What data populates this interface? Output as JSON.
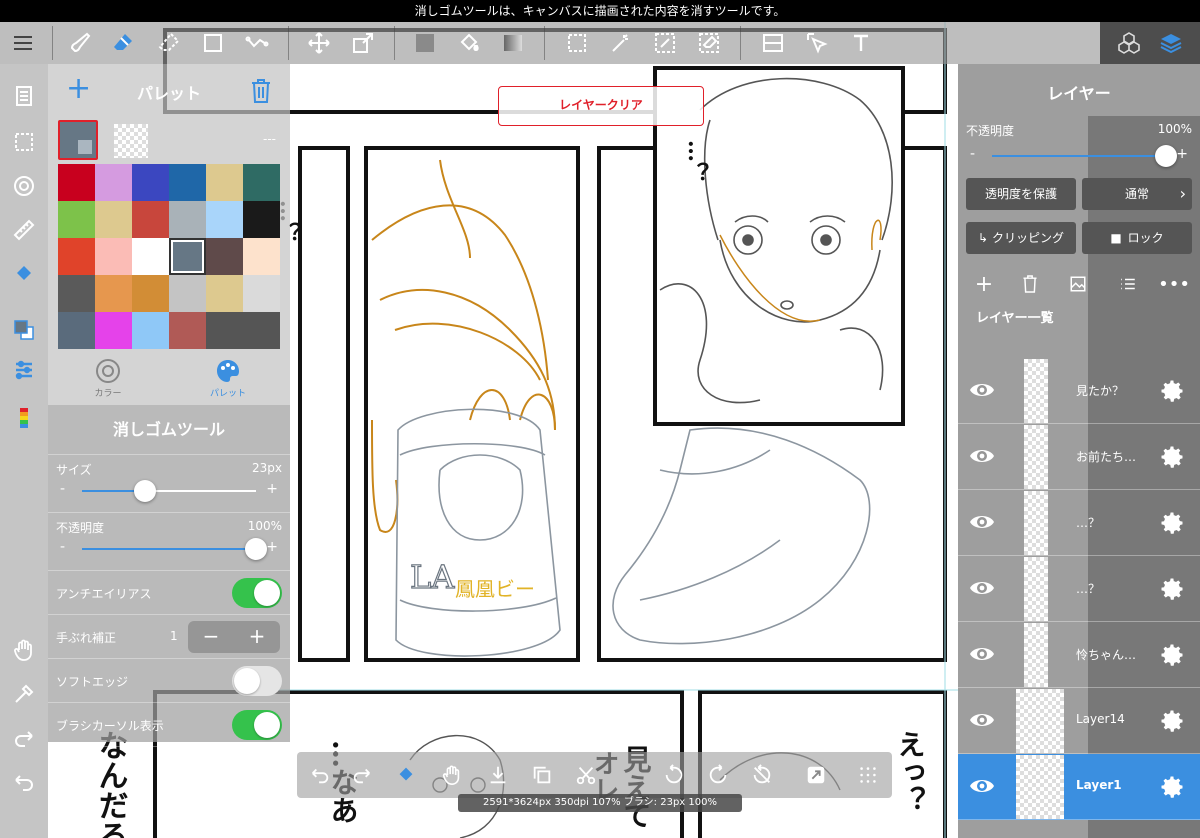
{
  "info_bar": {
    "message": "消しゴムツールは、キャンバスに描画された内容を消すツールです。"
  },
  "clear_button": {
    "label": "レイヤークリア"
  },
  "palette": {
    "title": "パレット",
    "current_label": "---",
    "swatches": [
      "#c8001e",
      "#d59be0",
      "#3b47c0",
      "#1f67a8",
      "#ddc98f",
      "#2f6b64",
      "#7dc24a",
      "#ddc98f",
      "#c8463c",
      "#a9b2b8",
      "#a9d5fa",
      "#1a1a1a",
      "#e0432a",
      "#fbbcb6",
      "#ffffff",
      "#667785",
      "#5f4a4a",
      "#fde2cc",
      "#5a5a5a",
      "#e6974e",
      "#d28d36",
      "#c4c4c4",
      "#ddc98f",
      "#dadada",
      "#5a6b7c",
      "#e542ea",
      "#8fc8f7",
      "#b05a56",
      "#555555",
      "#555555"
    ],
    "tabs": [
      {
        "label": "カラー"
      },
      {
        "label": "パレット"
      }
    ]
  },
  "eraser": {
    "title": "消しゴムツール",
    "size_label": "サイズ",
    "size_value": "23px",
    "size_level": 0.36,
    "opacity_label": "不透明度",
    "opacity_value": "100%",
    "opacity_level": 1.0,
    "antialias_label": "アンチエイリアス",
    "antialias_on": true,
    "stabilizer_label": "手ぶれ補正",
    "stabilizer_value": "1",
    "stepper_minus": "−",
    "stepper_plus": "+",
    "softedge_label": "ソフトエッジ",
    "softedge_on": false,
    "cursor_label": "ブラシカーソル表示",
    "cursor_on": true
  },
  "layers": {
    "title": "レイヤー",
    "opacity_label": "不透明度",
    "opacity_value": "100%",
    "opacity_level": 1.0,
    "protect_label": "透明度を保護",
    "blend_label": "通常",
    "clipping_label": "クリッピング",
    "lock_label": "ロック",
    "list_label": "レイヤー一覧",
    "items": [
      {
        "name": "見たか？",
        "selected": false
      },
      {
        "name": "お前たち…",
        "selected": false
      },
      {
        "name": "…？",
        "selected": false
      },
      {
        "name": "…？",
        "selected": false
      },
      {
        "name": "怜ちゃん…",
        "selected": false
      },
      {
        "name": "Layer14",
        "selected": false
      },
      {
        "name": "Layer1",
        "selected": true
      }
    ]
  },
  "canvas_text": {
    "q1": "…？",
    "q2": "…？",
    "ban1": "なんだろ",
    "ban2": "…なあ",
    "ban3": "見えて",
    "ban3b": "オレ",
    "ban4": "えっ？",
    "can1": "鳳凰ビー",
    "can2": "LA"
  },
  "status": {
    "text": "2591*3624px 350dpi 107% ブラシ: 23px 100%"
  }
}
